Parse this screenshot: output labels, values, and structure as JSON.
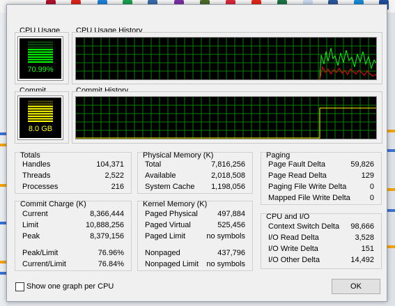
{
  "taskbar": {
    "icons": [
      "app-icon",
      "pdf-icon",
      "check-icon",
      "evernote-icon",
      "media-icon",
      "onenote-icon",
      "tree-icon",
      "bookmark-icon",
      "acrobat-icon",
      "excel-icon",
      "file-icon",
      "word-icon",
      "app2-icon",
      "app3-icon"
    ]
  },
  "cpu_usage": {
    "label": "CPU Usage",
    "value": "70.99%",
    "percent": 0.7099
  },
  "cpu_history": {
    "label": "CPU Usage History"
  },
  "commit": {
    "label": "Commit",
    "value": "8.0 GB",
    "fraction": 0.7684
  },
  "commit_history": {
    "label": "Commit History"
  },
  "totals": {
    "title": "Totals",
    "rows": [
      {
        "label": "Handles",
        "value": "104,371"
      },
      {
        "label": "Threads",
        "value": "2,522"
      },
      {
        "label": "Processes",
        "value": "216"
      }
    ]
  },
  "commit_charge": {
    "title": "Commit Charge (K)",
    "rows": [
      {
        "label": "Current",
        "value": "8,366,444"
      },
      {
        "label": "Limit",
        "value": "10,888,256"
      },
      {
        "label": "Peak",
        "value": "8,379,156"
      },
      {
        "label": "Peak/Limit",
        "value": "76.96%"
      },
      {
        "label": "Current/Limit",
        "value": "76.84%"
      }
    ]
  },
  "physical_memory": {
    "title": "Physical Memory (K)",
    "rows": [
      {
        "label": "Total",
        "value": "7,816,256"
      },
      {
        "label": "Available",
        "value": "2,018,508"
      },
      {
        "label": "System Cache",
        "value": "1,198,056"
      }
    ]
  },
  "kernel_memory": {
    "title": "Kernel Memory (K)",
    "rows": [
      {
        "label": "Paged Physical",
        "value": "497,884"
      },
      {
        "label": "Paged Virtual",
        "value": "525,456"
      },
      {
        "label": "Paged Limit",
        "value": "no symbols"
      },
      {
        "label": "Nonpaged",
        "value": "437,796"
      },
      {
        "label": "Nonpaged Limit",
        "value": "no symbols"
      }
    ]
  },
  "paging": {
    "title": "Paging",
    "rows": [
      {
        "label": "Page Fault Delta",
        "value": "59,826"
      },
      {
        "label": "Page Read Delta",
        "value": "129"
      },
      {
        "label": "Paging File Write Delta",
        "value": "0"
      },
      {
        "label": "Mapped File Write Delta",
        "value": "0"
      }
    ]
  },
  "cpu_io": {
    "title": "CPU and I/O",
    "rows": [
      {
        "label": "Context Switch Delta",
        "value": "98,666"
      },
      {
        "label": "I/O Read Delta",
        "value": "3,528"
      },
      {
        "label": "I/O Write Delta",
        "value": "151"
      },
      {
        "label": "I/O Other Delta",
        "value": "14,492"
      }
    ]
  },
  "footer": {
    "checkbox_label": "Show one graph per CPU",
    "checkbox_checked": false,
    "ok_label": "OK"
  },
  "colors": {
    "graph_grid": "#008000",
    "cpu_line": "#00ff00",
    "kernel_line": "#ff0000",
    "commit_line": "#ffff00"
  }
}
